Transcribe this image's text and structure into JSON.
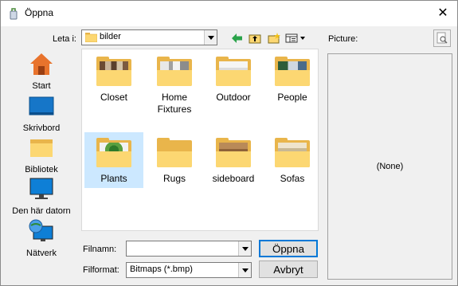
{
  "window": {
    "title": "Öppna",
    "close_glyph": "✕"
  },
  "look_in": {
    "label": "Leta i:",
    "value": "bilder"
  },
  "toolbar": {
    "icons": [
      "back-icon",
      "up-folder-icon",
      "new-folder-icon",
      "view-menu-icon"
    ]
  },
  "places": [
    {
      "label": "Start",
      "icon": "start-icon"
    },
    {
      "label": "Skrivbord",
      "icon": "desktop-icon"
    },
    {
      "label": "Bibliotek",
      "icon": "library-icon"
    },
    {
      "label": "Den här datorn",
      "icon": "computer-icon"
    },
    {
      "label": "Nätverk",
      "icon": "network-icon"
    }
  ],
  "files": [
    {
      "name": "Closet",
      "selected": false
    },
    {
      "name": "Home Fixtures",
      "selected": false
    },
    {
      "name": "Outdoor",
      "selected": false
    },
    {
      "name": "People",
      "selected": false
    },
    {
      "name": "Plants",
      "selected": true
    },
    {
      "name": "Rugs",
      "selected": false
    },
    {
      "name": "sideboard",
      "selected": false
    },
    {
      "name": "Sofas",
      "selected": false
    }
  ],
  "filename": {
    "label": "Filnamn:",
    "value": ""
  },
  "filetype": {
    "label": "Filformat:",
    "value": "Bitmaps (*.bmp)"
  },
  "buttons": {
    "open": "Öppna",
    "cancel": "Avbryt"
  },
  "preview": {
    "label": "Picture:",
    "empty_text": "(None)"
  },
  "colors": {
    "selection": "#cce8ff",
    "folder": "#fcd772",
    "default_button_border": "#0078d7"
  }
}
